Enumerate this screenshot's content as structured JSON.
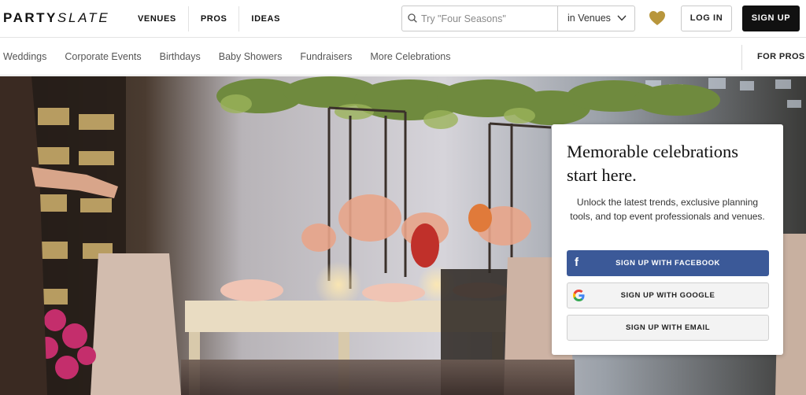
{
  "header": {
    "logo_part1": "PARTY",
    "logo_part2": "SLATE",
    "nav": [
      "VENUES",
      "PROS",
      "IDEAS"
    ],
    "search": {
      "placeholder": "Try \"Four Seasons\"",
      "scope": "in Venues"
    },
    "login_label": "LOG IN",
    "signup_label": "SIGN UP",
    "heart_color": "#b8963c"
  },
  "subnav": {
    "categories": [
      "Weddings",
      "Corporate Events",
      "Birthdays",
      "Baby Showers",
      "Fundraisers",
      "More Celebrations"
    ],
    "for_pros": "FOR PROS"
  },
  "card": {
    "headline_line1": "Memorable celebrations",
    "headline_line2": "start here.",
    "body": "Unlock the latest trends, exclusive planning tools, and top event professionals and venues.",
    "facebook_label": "SIGN UP WITH FACEBOOK",
    "google_label": "SIGN UP WITH GOOGLE",
    "email_label": "SIGN UP WITH EMAIL",
    "facebook_color": "#3b5998"
  }
}
